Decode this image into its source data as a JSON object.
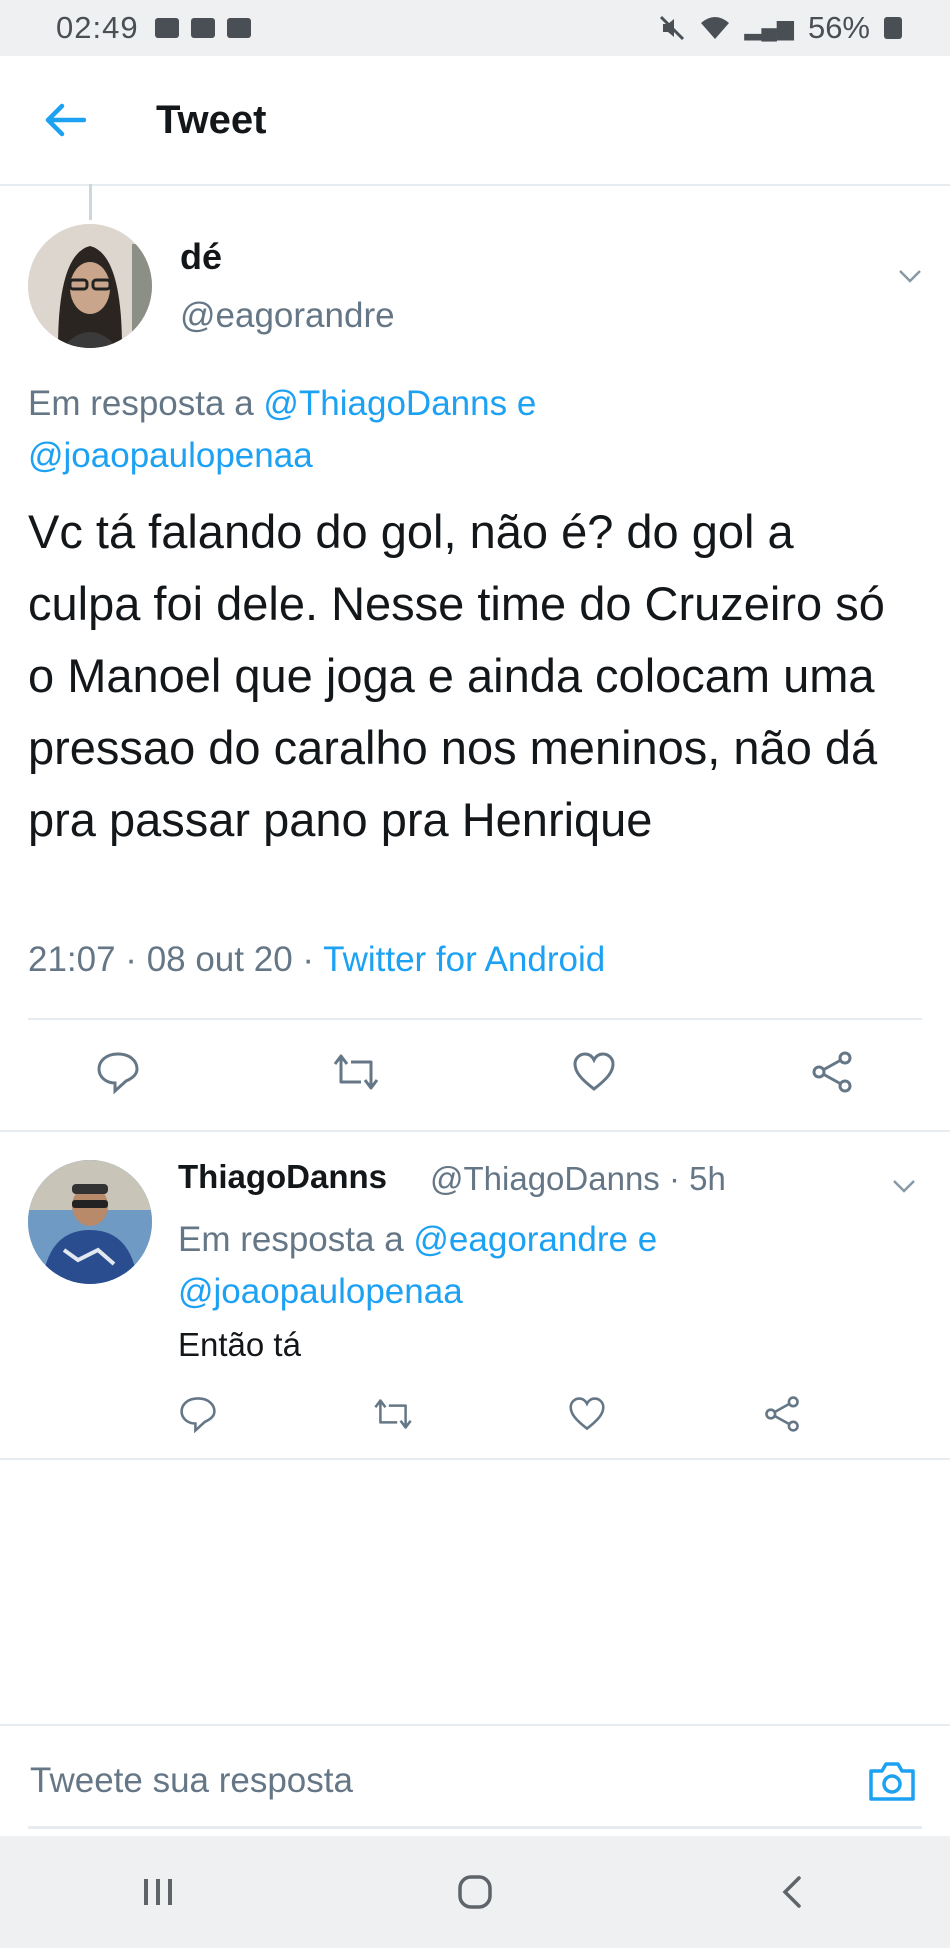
{
  "status_bar": {
    "time": "02:49",
    "battery": "56%"
  },
  "header": {
    "title": "Tweet"
  },
  "main_tweet": {
    "name": "dé",
    "handle": "@eagorandre",
    "reply_prefix": "Em resposta a ",
    "reply_user_1": "@ThiagoDanns",
    "reply_conjunction": " e",
    "reply_user_2": "@joaopaulopenaa",
    "text": "Vc tá falando do gol, não é? do gol a culpa foi dele. Nesse time do Cruzeiro só o Manoel que joga e ainda colocam uma pressao do caralho nos meninos, não dá pra passar pano pra Henrique",
    "timestamp": "21:07 · 08 out 20 · ",
    "source": "Twitter for Android"
  },
  "reply_tweet": {
    "name": "ThiagoDanns",
    "handle_time": "@ThiagoDanns · 5h",
    "reply_prefix": "Em resposta a ",
    "reply_user_1": "@eagorandre",
    "reply_conjunction": " e",
    "reply_user_2": "@joaopaulopenaa",
    "text": "Então tá"
  },
  "compose": {
    "placeholder": "Tweete sua resposta"
  },
  "colors": {
    "accent": "#1da1f2",
    "secondary_text": "#657786",
    "primary_text": "#14171a",
    "divider": "#e6ecf0"
  },
  "icons": {
    "back": "arrow-left-icon",
    "reply": "comment-icon",
    "retweet": "retweet-icon",
    "like": "heart-icon",
    "share": "share-icon",
    "camera": "camera-icon"
  }
}
